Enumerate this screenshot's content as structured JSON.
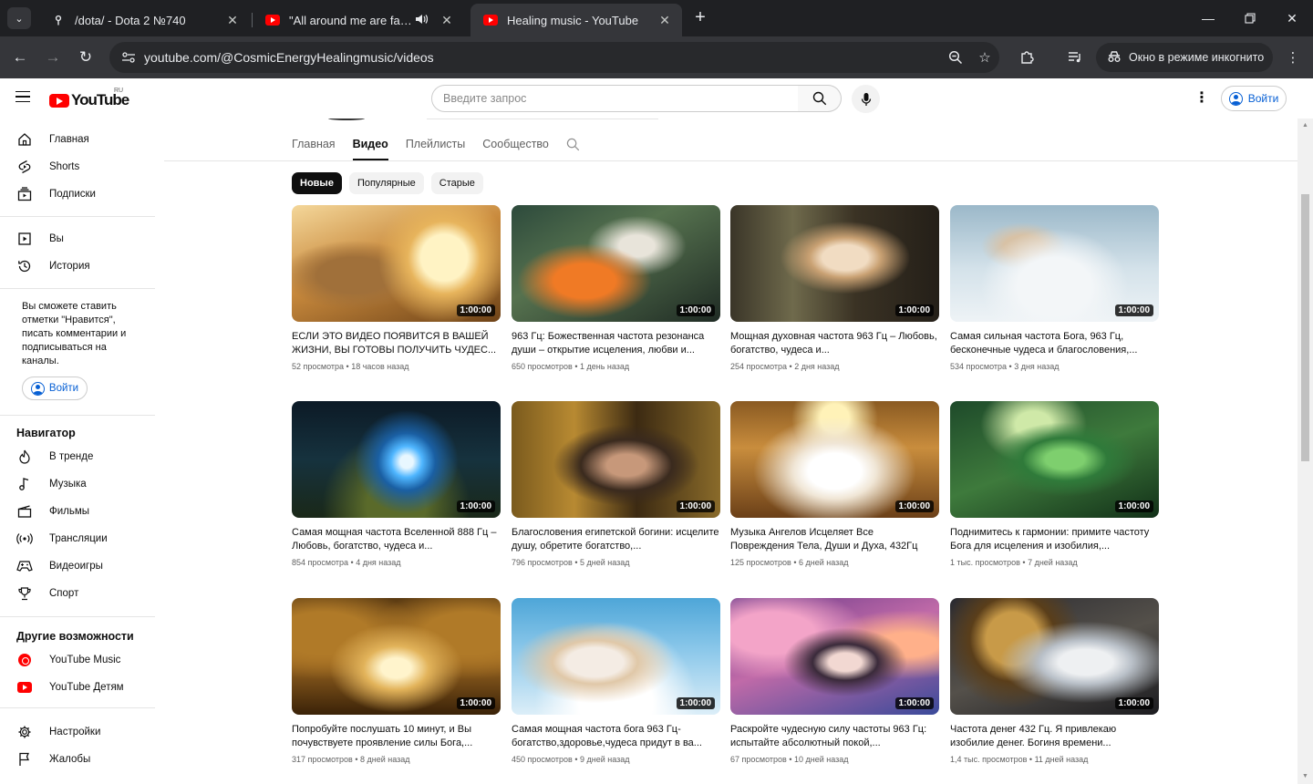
{
  "browser": {
    "tabs": [
      {
        "title": "/dota/ - Dota 2 №740",
        "icon": "site-icon"
      },
      {
        "title": "\"All around me are familiar faces\"",
        "icon": "youtube-icon",
        "audio": true
      },
      {
        "title": "Healing music - YouTube",
        "icon": "youtube-icon",
        "active": true
      }
    ],
    "url": "youtube.com/@CosmicEnergyHealingmusic/videos",
    "incognito_label": "Окно в режиме инкогнито"
  },
  "header": {
    "logo_text": "YouTube",
    "country_code": "RU",
    "search_placeholder": "Введите запрос",
    "signin_label": "Войти"
  },
  "sidebar": {
    "main": [
      {
        "label": "Главная",
        "icon": "home-icon"
      },
      {
        "label": "Shorts",
        "icon": "shorts-icon"
      },
      {
        "label": "Подписки",
        "icon": "subscriptions-icon"
      }
    ],
    "you": [
      {
        "label": "Вы",
        "icon": "you-icon"
      },
      {
        "label": "История",
        "icon": "history-icon"
      }
    ],
    "signin_note": "Вы сможете ставить отметки \"Нравится\", писать комментарии и подписываться на каналы.",
    "signin_label": "Войти",
    "navigator_title": "Навигатор",
    "navigator": [
      {
        "label": "В тренде",
        "icon": "trending-icon"
      },
      {
        "label": "Музыка",
        "icon": "music-icon"
      },
      {
        "label": "Фильмы",
        "icon": "movies-icon"
      },
      {
        "label": "Трансляции",
        "icon": "live-icon"
      },
      {
        "label": "Видеоигры",
        "icon": "gaming-icon"
      },
      {
        "label": "Спорт",
        "icon": "sports-icon"
      }
    ],
    "more_title": "Другие возможности",
    "more": [
      {
        "label": "YouTube Music",
        "icon": "youtube-music-icon"
      },
      {
        "label": "YouTube Детям",
        "icon": "youtube-kids-icon"
      }
    ],
    "settings": [
      {
        "label": "Настройки",
        "icon": "settings-icon"
      },
      {
        "label": "Жалобы",
        "icon": "flag-icon"
      }
    ]
  },
  "channel": {
    "tabs": [
      "Главная",
      "Видео",
      "Плейлисты",
      "Сообщество"
    ],
    "active_tab": "Видео",
    "chips": [
      "Новые",
      "Популярные",
      "Старые"
    ],
    "active_chip": "Новые"
  },
  "videos": [
    {
      "title": "ЕСЛИ ЭТО ВИДЕО ПОЯВИТСЯ В ВАШЕЙ ЖИЗНИ, ВЫ ГОТОВЫ ПОЛУЧИТЬ ЧУДЕС...",
      "views": "52 просмотра",
      "age": "18 часов назад",
      "duration": "1:00:00"
    },
    {
      "title": "963 Гц: Божественная частота резонанса души – открытие исцеления, любви и...",
      "views": "650 просмотров",
      "age": "1 день назад",
      "duration": "1:00:00"
    },
    {
      "title": "Мощная духовная частота 963 Гц – Любовь, богатство, чудеса и...",
      "views": "254 просмотра",
      "age": "2 дня назад",
      "duration": "1:00:00"
    },
    {
      "title": "Самая сильная частота Бога, 963 Гц, бесконечные чудеса и благословения,...",
      "views": "534 просмотра",
      "age": "3 дня назад",
      "duration": "1:00:00"
    },
    {
      "title": "Самая мощная частота Вселенной 888 Гц – Любовь, богатство, чудеса и...",
      "views": "854 просмотра",
      "age": "4 дня назад",
      "duration": "1:00:00"
    },
    {
      "title": "Благословения египетской богини: исцелите душу, обретите богатство,...",
      "views": "796 просмотров",
      "age": "5 дней назад",
      "duration": "1:00:00"
    },
    {
      "title": "Музыка Ангелов Исцеляет Все Повреждения Тела, Души и Духа, 432Гц",
      "views": "125 просмотров",
      "age": "6 дней назад",
      "duration": "1:00:00"
    },
    {
      "title": "Поднимитесь к гармонии: примите частоту Бога для исцеления и изобилия,...",
      "views": "1 тыс. просмотров",
      "age": "7 дней назад",
      "duration": "1:00:00"
    },
    {
      "title": "Попробуйте послушать 10 минут, и Вы почувствуете проявление силы Бога,...",
      "views": "317 просмотров",
      "age": "8 дней назад",
      "duration": "1:00:00"
    },
    {
      "title": "Самая мощная частота бога 963 Гц- богатство,здоровье,чудеса придут в ва...",
      "views": "450 просмотров",
      "age": "9 дней назад",
      "duration": "1:00:00"
    },
    {
      "title": "Раскройте чудесную силу частоты 963 Гц: испытайте абсолютный покой,...",
      "views": "67 просмотров",
      "age": "10 дней назад",
      "duration": "1:00:00"
    },
    {
      "title": "Частота денег 432 Гц. Я привлекаю изобилие денег. Богиня времени...",
      "views": "1,4 тыс. просмотров",
      "age": "11 дней назад",
      "duration": "1:00:00"
    }
  ]
}
